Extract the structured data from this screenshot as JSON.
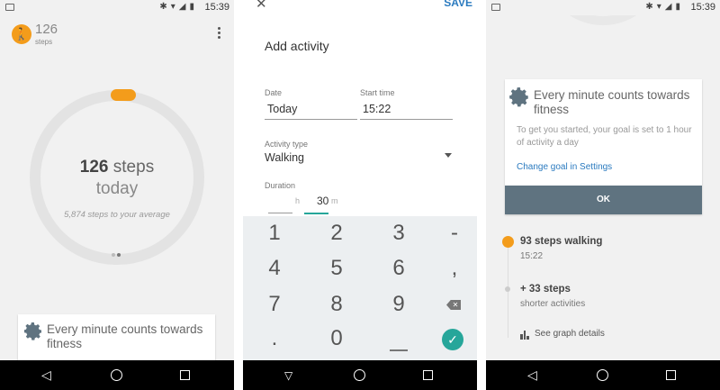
{
  "status_bar": {
    "time": "15:39"
  },
  "panel1": {
    "steps_count": "126",
    "steps_unit": "steps",
    "ring_value": "126",
    "ring_unit": "steps",
    "ring_sub": "today",
    "ring_avg": "5,874 steps to your average",
    "card_title": "Every minute counts towards fitness",
    "progress_fraction": 0.02
  },
  "panel2": {
    "save_label": "SAVE",
    "title": "Add activity",
    "date_label": "Date",
    "date_value": "Today",
    "start_time_label": "Start time",
    "start_time_value": "15:22",
    "activity_type_label": "Activity type",
    "activity_type_value": "Walking",
    "duration_label": "Duration",
    "duration_hours_unit": "h",
    "duration_minutes_value": "30",
    "duration_minutes_unit": "m",
    "keys": [
      "1",
      "2",
      "3",
      "-",
      "4",
      "5",
      "6",
      ",",
      "7",
      "8",
      "9",
      ".",
      "0"
    ]
  },
  "panel3": {
    "card_title": "Every minute counts towards fitness",
    "card_body": "To get you started, your goal is set to 1 hour of activity a day",
    "card_link": "Change goal in Settings",
    "ok_label": "OK",
    "timeline": [
      {
        "title": "93 steps walking",
        "sub": "15:22"
      },
      {
        "title": "+ 33 steps",
        "sub": "shorter activities"
      }
    ],
    "graph_link": "See graph details"
  },
  "colors": {
    "accent_orange": "#f39c1b",
    "teal": "#26a69a",
    "link_blue": "#2a7abf",
    "ok_bar": "#5f7380"
  }
}
